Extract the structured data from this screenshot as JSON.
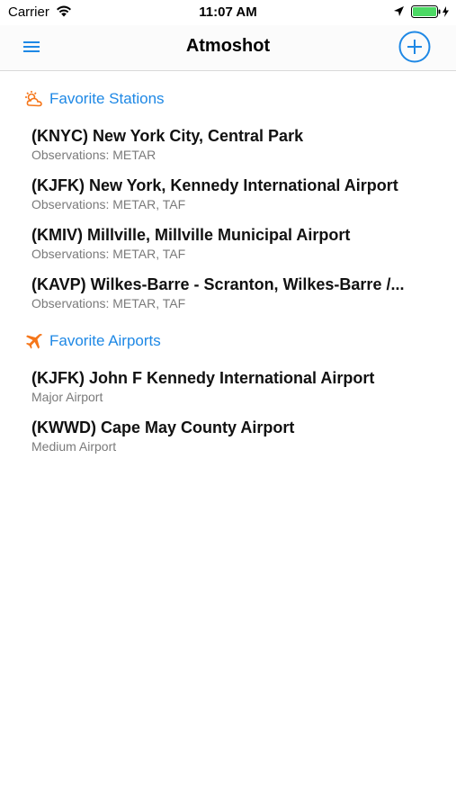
{
  "status_bar": {
    "carrier": "Carrier",
    "time": "11:07 AM"
  },
  "nav": {
    "title": "Atmoshot"
  },
  "colors": {
    "accent": "#1e88e5",
    "section_icon": "#f5761a",
    "battery": "#4cd964"
  },
  "icons": {
    "menu": "hamburger-menu-icon",
    "add": "plus-circle-icon",
    "stations": "cloud-sun-icon",
    "airports": "airplane-icon"
  },
  "stations": {
    "header": "Favorite Stations",
    "items": [
      {
        "title": "(KNYC) New York City, Central Park",
        "subtitle": "Observations: METAR"
      },
      {
        "title": "(KJFK) New York, Kennedy International Airport",
        "subtitle": "Observations: METAR, TAF"
      },
      {
        "title": "(KMIV) Millville, Millville Municipal Airport",
        "subtitle": "Observations: METAR, TAF"
      },
      {
        "title": "(KAVP) Wilkes-Barre - Scranton, Wilkes-Barre /...",
        "subtitle": "Observations: METAR, TAF"
      }
    ]
  },
  "airports": {
    "header": "Favorite Airports",
    "items": [
      {
        "title": "(KJFK) John F Kennedy International Airport",
        "subtitle": "Major Airport"
      },
      {
        "title": "(KWWD) Cape May County Airport",
        "subtitle": "Medium Airport"
      }
    ]
  }
}
